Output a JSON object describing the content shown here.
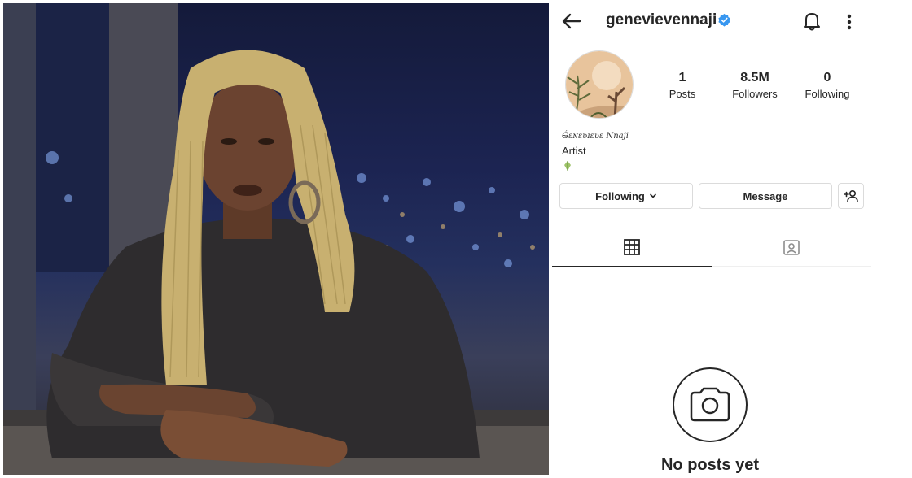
{
  "profile": {
    "username": "genevievennaji",
    "verified": true,
    "display_name": "Ǵ̴ɛɴɛʋɪɛʋɛ Nnaji",
    "bio": "Artist",
    "stats": {
      "posts": {
        "value": "1",
        "label": "Posts"
      },
      "followers": {
        "value": "8.5M",
        "label": "Followers"
      },
      "following": {
        "value": "0",
        "label": "Following"
      }
    },
    "buttons": {
      "following": "Following",
      "message": "Message"
    },
    "empty_state": "No posts yet"
  },
  "icons": {
    "back": "arrow-left-icon",
    "verified": "verified-badge-icon",
    "notifications": "bell-icon",
    "more": "more-vertical-icon",
    "add_user": "add-user-icon",
    "grid": "grid-icon",
    "tagged": "tagged-icon",
    "camera": "camera-icon"
  },
  "colors": {
    "verified": "#3897f0",
    "text": "#262626",
    "border": "#dbdbdb"
  }
}
